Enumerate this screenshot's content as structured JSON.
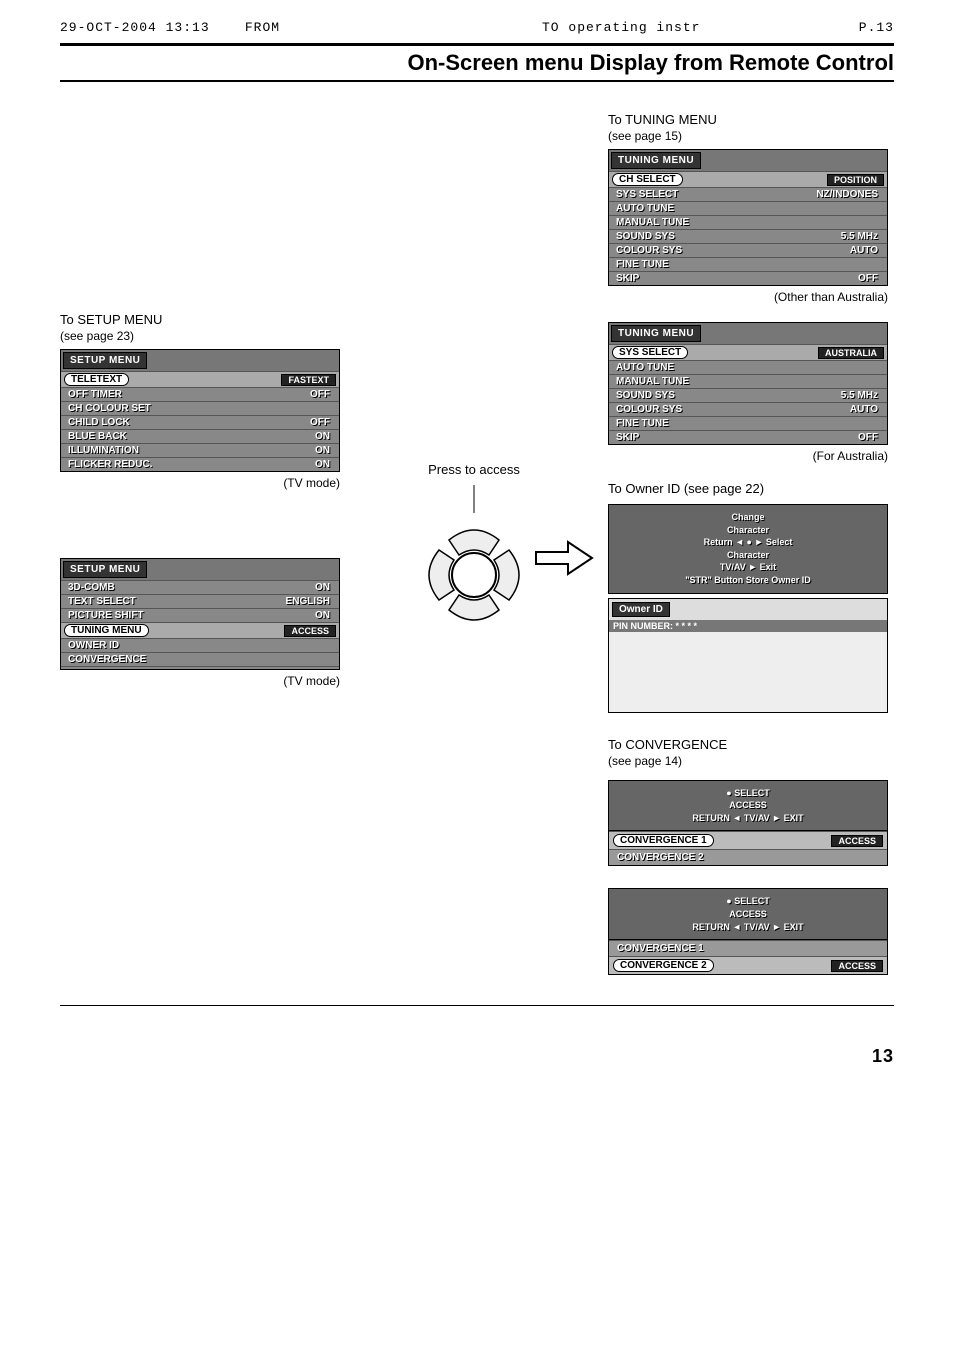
{
  "fax": {
    "date": "29-OCT-2004  13:13",
    "from": "FROM",
    "to": "TO  operating instr",
    "page": "P.13"
  },
  "title": "On-Screen menu Display from Remote Control",
  "setup": {
    "heading_prefix": "To ",
    "heading_bold": "SETUP",
    "heading_suffix": " MENU",
    "sub": "(see page 23)",
    "menu1": {
      "title": "SETUP MENU",
      "rows": [
        {
          "label": "TELETEXT",
          "val": "FASTEXT",
          "hl": true
        },
        {
          "label": "OFF TIMER",
          "val": "OFF"
        },
        {
          "label": "CH COLOUR SET",
          "val": ""
        },
        {
          "label": "CHILD LOCK",
          "val": "OFF"
        },
        {
          "label": "BLUE BACK",
          "val": "ON"
        },
        {
          "label": "ILLUMINATION",
          "val": "ON"
        },
        {
          "label": "FLICKER REDUC.",
          "val": "ON"
        }
      ],
      "caption": "(TV mode)"
    },
    "menu2": {
      "title": "SETUP MENU",
      "rows": [
        {
          "label": "3D-COMB",
          "val": "ON"
        },
        {
          "label": "TEXT SELECT",
          "val": "ENGLISH"
        },
        {
          "label": "PICTURE SHIFT",
          "val": "ON"
        },
        {
          "label": "TUNING MENU",
          "val": "ACCESS",
          "hl": true
        },
        {
          "label": "OWNER ID",
          "val": ""
        },
        {
          "label": "CONVERGENCE",
          "val": ""
        },
        {
          "label": "",
          "val": ""
        }
      ],
      "caption": "(TV mode)"
    }
  },
  "center": {
    "press": "Press to access"
  },
  "tuning": {
    "heading_prefix": "To ",
    "heading_bold": "TUNING",
    "heading_suffix": " MENU",
    "sub": "(see page 15)",
    "menuA": {
      "title": "TUNING MENU",
      "rows": [
        {
          "label": "CH SELECT",
          "val": "POSITION",
          "hl": true
        },
        {
          "label": "SYS SELECT",
          "val": "NZ/INDONES"
        },
        {
          "label": "AUTO TUNE",
          "val": ""
        },
        {
          "label": "MANUAL TUNE",
          "val": ""
        },
        {
          "label": "SOUND SYS",
          "val": "5.5 MHz"
        },
        {
          "label": "COLOUR SYS",
          "val": "AUTO"
        },
        {
          "label": "FINE TUNE",
          "val": ""
        },
        {
          "label": "SKIP",
          "val": "OFF"
        }
      ],
      "caption": "(Other than Australia)"
    },
    "menuB": {
      "title": "TUNING MENU",
      "rows": [
        {
          "label": "SYS SELECT",
          "val": "AUSTRALIA",
          "hl": true
        },
        {
          "label": "AUTO TUNE",
          "val": ""
        },
        {
          "label": "MANUAL TUNE",
          "val": ""
        },
        {
          "label": "SOUND SYS",
          "val": "5.5 MHz"
        },
        {
          "label": "COLOUR SYS",
          "val": "AUTO"
        },
        {
          "label": "FINE TUNE",
          "val": ""
        },
        {
          "label": "SKIP",
          "val": "OFF"
        }
      ],
      "caption": "(For Australia)"
    }
  },
  "owner": {
    "heading": "To Owner ID (see page 22)",
    "help": {
      "l1": "Change",
      "l2": "Character",
      "l3": "Return ◄ ● ► Select",
      "l4": "Character",
      "l5": "TV/AV ► Exit",
      "l6": "\"STR\" Button Store Owner ID"
    },
    "block": {
      "title": "Owner ID",
      "line": "PIN NUMBER: * * * *"
    }
  },
  "convergence": {
    "heading_prefix": "To ",
    "heading_bold": "CONVERGENCE",
    "sub": "(see page 14)",
    "help": {
      "l1": "● SELECT",
      "l2": "ACCESS",
      "l3": "RETURN ◄ TV/AV ► EXIT"
    },
    "block1": {
      "rows": [
        {
          "label": "CONVERGENCE 1",
          "val": "ACCESS",
          "hl": true
        },
        {
          "label": "CONVERGENCE 2",
          "val": ""
        }
      ]
    },
    "block2": {
      "rows": [
        {
          "label": "CONVERGENCE 1",
          "val": ""
        },
        {
          "label": "CONVERGENCE 2",
          "val": "ACCESS",
          "hl": true
        }
      ]
    }
  },
  "pagenum": "13"
}
